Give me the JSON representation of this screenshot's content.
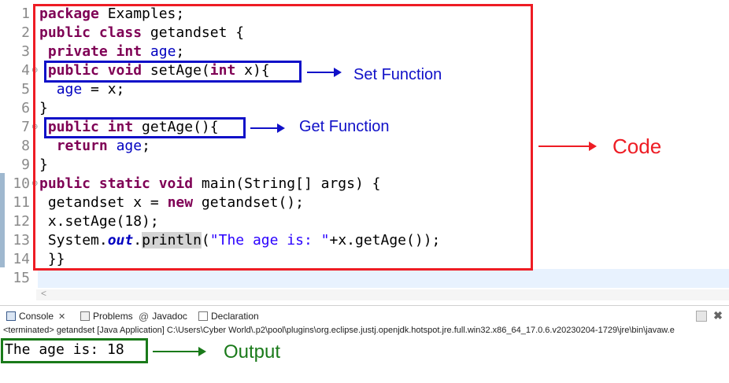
{
  "editor": {
    "line_numbers": [
      "1",
      "2",
      "3",
      "4",
      "5",
      "6",
      "7",
      "8",
      "9",
      "10",
      "11",
      "12",
      "13",
      "14",
      "15"
    ],
    "code": {
      "l1": {
        "kw": "package",
        "rest": " Examples;"
      },
      "l2": {
        "kw": "public class",
        "rest": " getandset {"
      },
      "l3": {
        "kw": "private int",
        "fd": "age",
        "rest": ";"
      },
      "l4": {
        "kw1": "public void",
        "mid": " setAge(",
        "kw2": "int",
        "rest": " x){"
      },
      "l5": {
        "fd": "age",
        "rest": " = x;"
      },
      "l6": {
        "rest": "}"
      },
      "l7": {
        "kw": "public int",
        "rest": " getAge(){"
      },
      "l8": {
        "kw": "return",
        "fd": "age",
        "rest": ";"
      },
      "l9": {
        "rest": "}"
      },
      "l10": {
        "kw": "public static void",
        "rest": " main(String[] args) {"
      },
      "l11": {
        "pre": "getandset x = ",
        "kw": "new",
        "rest": " getandset();"
      },
      "l12": {
        "rest": "x.setAge(18);"
      },
      "l13": {
        "pre": "System.",
        "it": "out",
        "dot": ".",
        "hl": "println",
        "open": "(",
        "st": "\"The age is: \"",
        "rest": "+x.getAge());"
      },
      "l14": {
        "rest": "}}"
      }
    }
  },
  "annotations": {
    "set_function": "Set Function",
    "get_function": "Get Function",
    "code": "Code",
    "output": "Output",
    "colors": {
      "blue": "#1010c8",
      "red": "#ee1c24",
      "green": "#1a7a1a"
    }
  },
  "console": {
    "tabs": [
      {
        "label": "Console",
        "icon": "console-icon"
      },
      {
        "label": "Problems",
        "icon": "problems-icon"
      },
      {
        "label": "Javadoc",
        "icon": "at-icon"
      },
      {
        "label": "Declaration",
        "icon": "declaration-icon"
      }
    ],
    "close_glyph": "✕",
    "status": "<terminated> getandset [Java Application] C:\\Users\\Cyber World\\.p2\\pool\\plugins\\org.eclipse.justj.openjdk.hotspot.jre.full.win32.x86_64_17.0.6.v20230204-1729\\jre\\bin\\javaw.e",
    "output": "The age is: 18"
  }
}
